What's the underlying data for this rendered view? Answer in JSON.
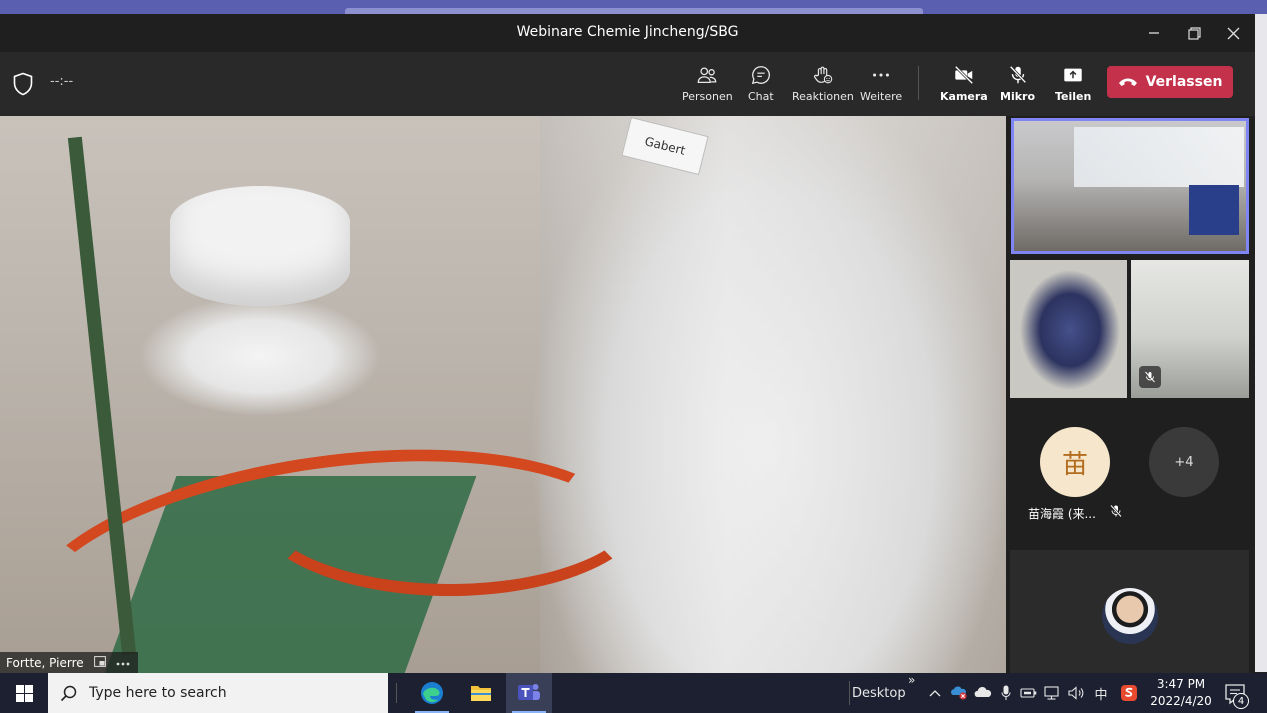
{
  "window": {
    "title": "Webinare Chemie Jincheng/SBG",
    "minimize_glyph": "—",
    "restore_glyph": "❐",
    "close_glyph": "✕"
  },
  "meeting": {
    "timer": "--:--",
    "tools": [
      {
        "label": "Personen",
        "icon": "people-icon"
      },
      {
        "label": "Chat",
        "icon": "chat-icon"
      },
      {
        "label": "Reaktionen",
        "icon": "reactions-icon"
      },
      {
        "label": "Weitere",
        "icon": "more-icon"
      },
      {
        "label": "Kamera",
        "icon": "camera-off-icon"
      },
      {
        "label": "Mikro",
        "icon": "mic-off-icon"
      },
      {
        "label": "Teilen",
        "icon": "share-icon"
      }
    ],
    "leave_label": "Verlassen",
    "colors": {
      "leave": "#c4314b",
      "active_border": "#7f85f5",
      "toolbar": "#292929"
    }
  },
  "main_video": {
    "speaker_name": "Fortte, Pierre",
    "coat_label": "Gabert"
  },
  "participants": {
    "avatar_initial": "苗",
    "avatar_name": "苗海霞 (来...",
    "overflow_count": "+4"
  },
  "taskbar": {
    "search_placeholder": "Type here to search",
    "desktop_label": "Desktop",
    "chevron": "»",
    "ime_label": "中",
    "time": "3:47 PM",
    "date": "2022/4/20",
    "notification_count": "4"
  }
}
